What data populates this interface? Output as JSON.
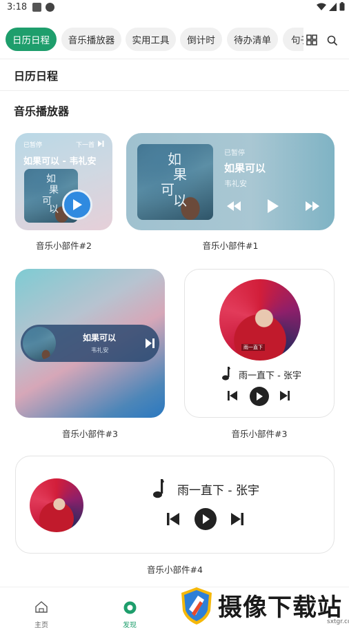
{
  "status_bar": {
    "time": "3:18"
  },
  "tabs": [
    {
      "label": "日历日程",
      "active": true
    },
    {
      "label": "音乐播放器",
      "active": false
    },
    {
      "label": "实用工具",
      "active": false
    },
    {
      "label": "倒计时",
      "active": false
    },
    {
      "label": "待办清单",
      "active": false
    },
    {
      "label": "句子",
      "active": false
    }
  ],
  "sections": {
    "calendar": "日历日程",
    "music": "音乐播放器"
  },
  "widget2": {
    "status": "已暂停",
    "next": "下一首",
    "title": "如果可以 - 韦礼安",
    "label": "音乐小部件#2"
  },
  "widget1": {
    "status": "已暂停",
    "song": "如果可以",
    "artist": "韦礼安",
    "label": "音乐小部件#1"
  },
  "widget3a": {
    "song": "如果可以",
    "artist": "韦礼安",
    "label": "音乐小部件#3"
  },
  "widget3b": {
    "track": "雨一直下 - 张宇",
    "avatar_caption": "雨一直下",
    "label": "音乐小部件#3"
  },
  "widget4": {
    "track": "雨一直下 - 张宇",
    "label": "音乐小部件#4"
  },
  "album_art": {
    "line1": "如",
    "line2": "果",
    "line3": "可",
    "line4": "以"
  },
  "bottom_nav": [
    {
      "label": "主页",
      "icon": "home-icon",
      "active": false
    },
    {
      "label": "发现",
      "icon": "discover-icon",
      "active": true
    }
  ],
  "watermark": {
    "text": "摄像下载站",
    "url": "sxtgr.com"
  },
  "colors": {
    "accent": "#1e9e6c"
  }
}
